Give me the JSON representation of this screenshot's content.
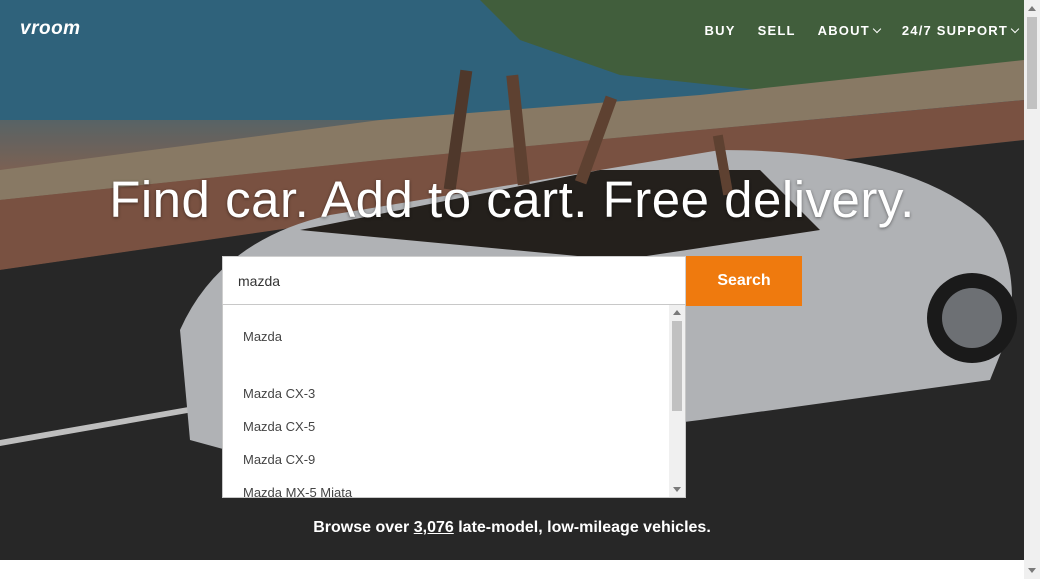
{
  "brand": {
    "logo": "vroom"
  },
  "nav": {
    "items": [
      {
        "label": "BUY"
      },
      {
        "label": "SELL"
      },
      {
        "label": "ABOUT"
      },
      {
        "label": "24/7 SUPPORT"
      }
    ]
  },
  "hero": {
    "headline": "Find car. Add to cart. Free delivery."
  },
  "search": {
    "value": "mazda",
    "button_label": "Search",
    "suggestions": [
      {
        "label": "Mazda"
      },
      {
        "label": "Mazda CX-3"
      },
      {
        "label": "Mazda CX-5"
      },
      {
        "label": "Mazda CX-9"
      },
      {
        "label": "Mazda MX-5 Miata"
      }
    ]
  },
  "browse": {
    "prefix": "Browse over",
    "count": "3,076",
    "suffix": "late-model, low-mileage vehicles."
  },
  "icons": {
    "about_chevron": "chevron-down-icon",
    "support_chevron": "chevron-down-icon"
  },
  "colors": {
    "search_button": "#ef7a0e"
  }
}
